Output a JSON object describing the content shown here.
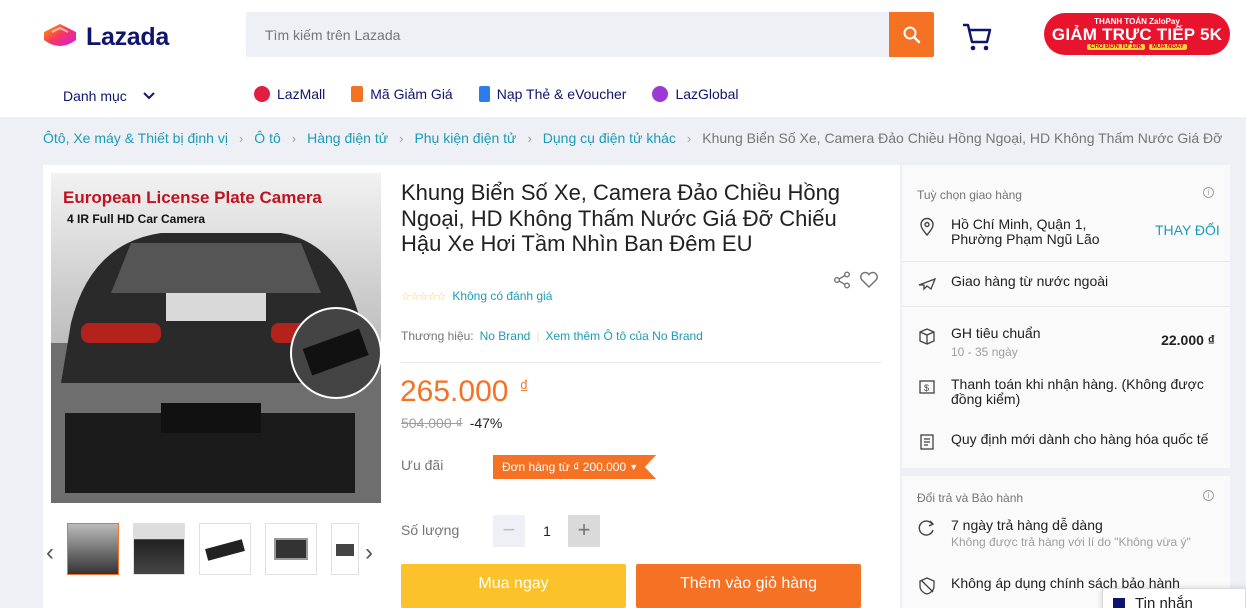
{
  "header": {
    "logo_text": "Lazada",
    "search": {
      "placeholder": "Tìm kiếm trên Lazada",
      "value": ""
    },
    "promo": {
      "top": "THANH TOÁN ZaloPay",
      "main": "GIẢM TRỰC TIẾP 5K",
      "bottom_left": "CHO ĐƠN TỪ 10K",
      "bottom_right": "MUA NGAY"
    },
    "category_label": "Danh mục",
    "nav": [
      {
        "label": "LazMall",
        "color": "#e21f43"
      },
      {
        "label": "Mã Giảm Giá",
        "color": "#f57224"
      },
      {
        "label": "Nạp Thẻ & eVoucher",
        "color": "#2b7de9"
      },
      {
        "label": "LazGlobal",
        "color": "#9b38d6"
      }
    ]
  },
  "breadcrumb": [
    "Ôtô, Xe máy & Thiết bị định vị",
    "Ô tô",
    "Hàng điện tử",
    "Phụ kiện điện tử",
    "Dụng cụ điện tử khác",
    "Khung Biển Số Xe, Camera Đảo Chiều Hồng Ngoại, HD Không Thấm Nước Giá Đỡ"
  ],
  "product": {
    "image_title": "European License Plate Camera",
    "image_subtitle": "4 IR Full HD Car Camera",
    "title": "Khung Biển Số Xe, Camera Đảo Chiều Hồng Ngoại, HD Không Thấm Nước Giá Đỡ Chiếu Hậu Xe Hơi Tầm Nhìn Ban Đêm EU",
    "rating_text": "Không có đánh giá",
    "stars": "☆☆☆☆☆",
    "brand_label": "Thương hiệu:",
    "brand_name": "No Brand",
    "brand_more": "Xem thêm Ô tô của No Brand",
    "price": "265.000",
    "currency": "₫",
    "old_price": "504.000 ₫",
    "discount": "-47%",
    "offers_label": "Ưu đãi",
    "offer_tag": "Đơn hàng từ ₫ 200.000",
    "qty_label": "Số lượng",
    "qty_value": "1",
    "qty_minus": "−",
    "qty_plus": "+",
    "buy_now": "Mua ngay",
    "add_to_cart": "Thêm vào giỏ hàng"
  },
  "delivery": {
    "heading": "Tuỳ chọn giao hàng",
    "location_line1": "Hồ Chí Minh, Quận 1,",
    "location_line2": "Phường Phạm Ngũ Lão",
    "change": "THAY ĐỔI",
    "overseas": "Giao hàng từ nước ngoài",
    "standard": "GH tiêu chuẩn",
    "standard_days": "10 - 35 ngày",
    "standard_fee": "22.000 ₫",
    "cod": "Thanh toán khi nhận hàng. (Không được đồng kiểm)",
    "policy": "Quy định mới dành cho hàng hóa quốc tế"
  },
  "returns": {
    "heading": "Đổi trả và Bảo hành",
    "return_days": "7 ngày trả hàng dễ dàng",
    "return_note": "Không được trả hàng với lí do \"Không vừa ý\"",
    "warranty": "Không áp dụng chính sách bảo hành"
  },
  "chat": {
    "label": "Tin nhắn"
  }
}
